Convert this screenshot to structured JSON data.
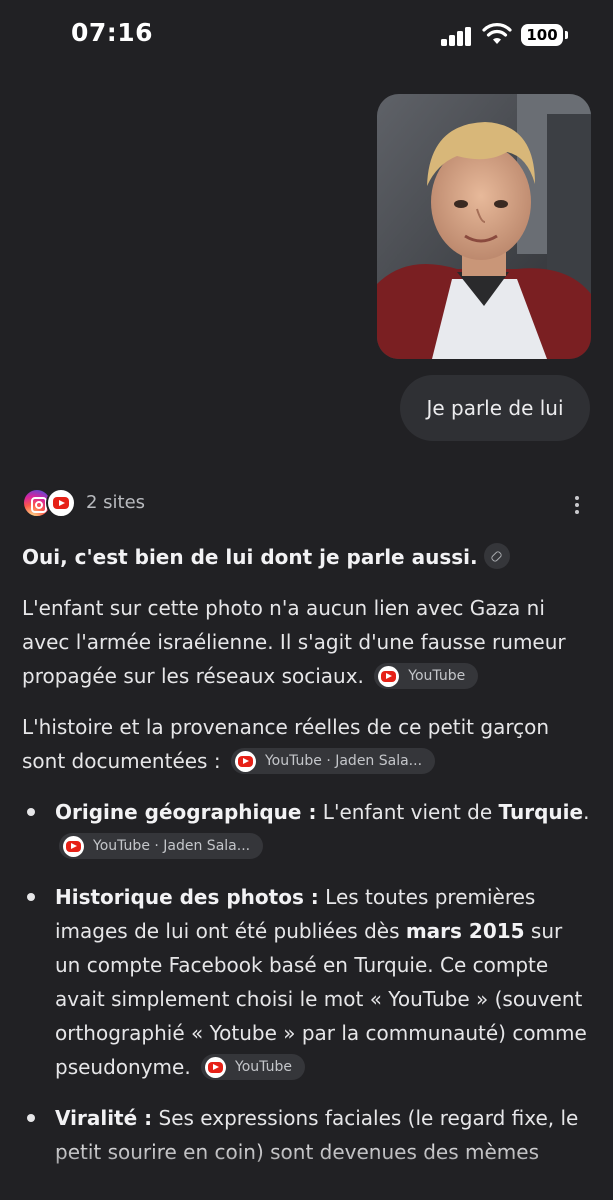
{
  "status_bar": {
    "time": "07:16",
    "battery": "100"
  },
  "conversation": {
    "user_image": {
      "description_icon": "photo-of-boy"
    },
    "user_message": "Je parle de lui",
    "sources": {
      "label": "2 sites",
      "icons": [
        "instagram-icon",
        "youtube-icon"
      ]
    },
    "answer": {
      "heading": "Oui, c'est bien de lui dont je parle aussi.",
      "para1": "L'enfant sur cette photo n'a aucun lien avec Gaza ni avec l'armée israélienne. Il s'agit d'une fausse rumeur propagée sur les réseaux sociaux.",
      "para1_chip": "YouTube",
      "para2": "L'histoire et la provenance réelles de ce petit garçon sont documentées :",
      "para2_chip": "YouTube · Jaden Sala...",
      "bullets": [
        {
          "title": "Origine géographique :",
          "text_a": " L'enfant vient de ",
          "bold_a": "Turquie",
          "text_b": ".",
          "chip": "YouTube · Jaden Sala..."
        },
        {
          "title": "Historique des photos :",
          "text_a": " Les toutes premières images de lui ont été publiées dès ",
          "bold_a": "mars 2015",
          "text_b": " sur un compte Facebook basé en Turquie. Ce compte avait simplement choisi le mot « YouTube » (souvent orthographié « Yotube » par la communauté) comme pseudonyme.",
          "chip": "YouTube"
        },
        {
          "title": "Viralité :",
          "text_a": " Ses expressions faciales (le regard fixe, le petit sourire en coin) sont devenues des mèmes",
          "bold_a": "",
          "text_b": "",
          "chip": ""
        }
      ]
    }
  },
  "colors": {
    "background": "#212124",
    "bubble": "#2f3034",
    "chip": "#35363a",
    "youtube_red": "#e62117"
  }
}
